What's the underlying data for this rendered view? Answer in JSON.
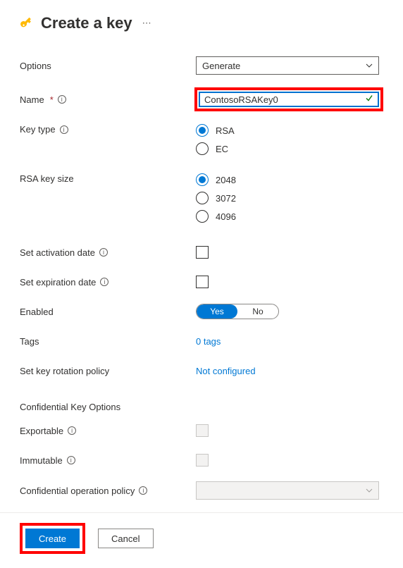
{
  "header": {
    "title": "Create a key"
  },
  "labels": {
    "options": "Options",
    "name": "Name",
    "keyType": "Key type",
    "rsaKeySize": "RSA key size",
    "activationDate": "Set activation date",
    "expirationDate": "Set expiration date",
    "enabled": "Enabled",
    "tags": "Tags",
    "rotationPolicy": "Set key rotation policy",
    "confidentialHeading": "Confidential Key Options",
    "exportable": "Exportable",
    "immutable": "Immutable",
    "confidentialOperationPolicy": "Confidential operation policy"
  },
  "values": {
    "optionsSelected": "Generate",
    "name": "ContosoRSAKey0",
    "keyType": {
      "rsa": "RSA",
      "ec": "EC",
      "selected": "RSA"
    },
    "rsaKeySize": {
      "s2048": "2048",
      "s3072": "3072",
      "s4096": "4096",
      "selected": "2048"
    },
    "activationDateChecked": false,
    "expirationDateChecked": false,
    "enabled": {
      "yes": "Yes",
      "no": "No",
      "selected": "Yes"
    },
    "tagsText": "0 tags",
    "rotationPolicyText": "Not configured",
    "exportableChecked": false,
    "immutableChecked": false
  },
  "buttons": {
    "create": "Create",
    "cancel": "Cancel"
  }
}
